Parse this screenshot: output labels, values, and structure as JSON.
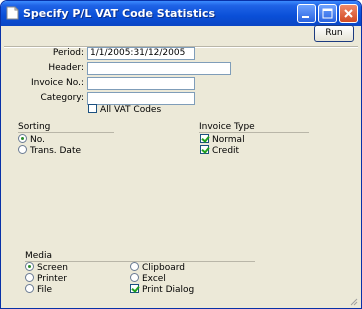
{
  "window": {
    "title": "Specify P/L VAT Code Statistics",
    "colors": {
      "titlebar": "#0a4fd8",
      "face": "#ece9d8",
      "field_border": "#7f9db9"
    }
  },
  "toolbar": {
    "run_label": "Run"
  },
  "form": {
    "period_label": "Period:",
    "period_value": "1/1/2005:31/12/2005",
    "header_label": "Header:",
    "header_value": "",
    "invoice_label": "Invoice No.:",
    "invoice_value": "",
    "category_label": "Category:",
    "category_value": "",
    "all_vat_label": "All VAT Codes",
    "all_vat_checked": false
  },
  "sorting": {
    "title": "Sorting",
    "options": [
      {
        "label": "No.",
        "selected": true
      },
      {
        "label": "Trans. Date",
        "selected": false
      }
    ]
  },
  "invoice_type": {
    "title": "Invoice Type",
    "options": [
      {
        "label": "Normal",
        "checked": true
      },
      {
        "label": "Credit",
        "checked": true
      }
    ]
  },
  "media": {
    "title": "Media",
    "options": [
      {
        "label": "Screen",
        "selected": true
      },
      {
        "label": "Printer",
        "selected": false
      },
      {
        "label": "File",
        "selected": false
      },
      {
        "label": "Clipboard",
        "selected": false
      },
      {
        "label": "Excel",
        "selected": false
      }
    ],
    "print_dialog_label": "Print Dialog",
    "print_dialog_checked": true
  }
}
